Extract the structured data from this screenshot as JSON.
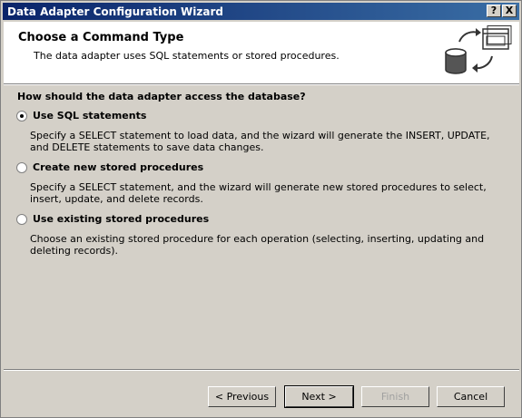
{
  "window": {
    "title": "Data Adapter Configuration Wizard",
    "help_label": "?",
    "close_label": "X"
  },
  "header": {
    "title": "Choose a Command Type",
    "subtitle": "The data adapter uses SQL statements or stored procedures.",
    "icon": "database-sync-icon"
  },
  "question": "How should the data adapter access the database?",
  "options": [
    {
      "label": "Use SQL statements",
      "checked": true,
      "description": "Specify a SELECT statement to load data, and the wizard will generate the INSERT, UPDATE, and DELETE statements to save data changes."
    },
    {
      "label": "Create new stored procedures",
      "checked": false,
      "description": "Specify a SELECT statement, and the wizard will generate new stored procedures to select, insert, update, and delete records."
    },
    {
      "label": "Use existing stored procedures",
      "checked": false,
      "description": "Choose an existing stored procedure for each operation (selecting, inserting, updating and deleting records)."
    }
  ],
  "buttons": {
    "previous": "< Previous",
    "next": "Next >",
    "finish": "Finish",
    "cancel": "Cancel"
  },
  "colors": {
    "titlebar_start": "#0a246a",
    "titlebar_end": "#3a6ea5",
    "dialog_face": "#d4d0c8"
  }
}
